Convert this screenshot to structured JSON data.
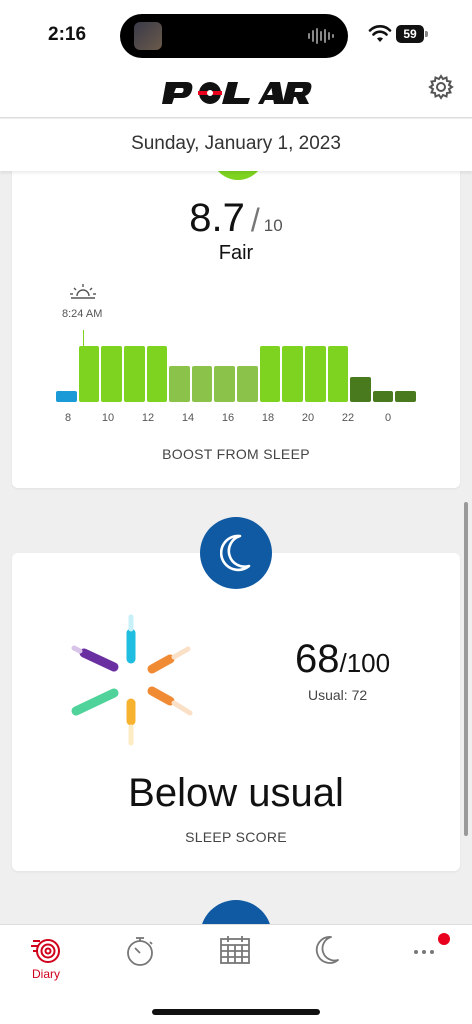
{
  "status_bar": {
    "time": "2:16",
    "battery": "59",
    "icons": [
      "wifi-icon",
      "battery-icon"
    ]
  },
  "header": {
    "logo_text": "POLAR",
    "settings_icon": "gear-icon"
  },
  "date": "Sunday, January 1, 2023",
  "nightly_recharge": {
    "value": "8.7",
    "slash": "/",
    "max": "10",
    "grade": "Fair",
    "wake_time": "8:24 AM",
    "label": "BOOST FROM SLEEP",
    "colors": {
      "blue": "#1a9ad6",
      "light_green": "#7ed321",
      "mid_green": "#8bc34a",
      "dark_green": "#4a7a1e"
    },
    "chart_data": {
      "type": "bar",
      "xlabel": "",
      "ylabel": "",
      "tick_labels": [
        "8",
        "10",
        "12",
        "14",
        "16",
        "18",
        "20",
        "22",
        "0"
      ],
      "values": [
        0.2,
        1.0,
        1.0,
        1.0,
        1.0,
        0.65,
        0.65,
        0.65,
        0.65,
        1.0,
        1.0,
        1.0,
        1.0,
        0.45,
        0.2,
        0.2
      ],
      "bar_colors": [
        "blue",
        "light_green",
        "light_green",
        "light_green",
        "light_green",
        "mid_green",
        "mid_green",
        "mid_green",
        "mid_green",
        "light_green",
        "light_green",
        "light_green",
        "light_green",
        "dark_green",
        "dark_green",
        "dark_green"
      ]
    }
  },
  "sleep": {
    "score": "68",
    "max": "/100",
    "usual": "Usual: 72",
    "verdict": "Below usual",
    "label": "SLEEP SCORE",
    "badge_icon": "moon-icon",
    "colors": {
      "badge": "#0f5aa3"
    }
  },
  "tabs": [
    {
      "name": "diary",
      "label": "Diary",
      "icon": "diary-icon",
      "active": true
    },
    {
      "name": "training",
      "label": "",
      "icon": "stopwatch-icon"
    },
    {
      "name": "calendar",
      "label": "",
      "icon": "calendar-icon"
    },
    {
      "name": "sleep",
      "label": "",
      "icon": "moon-icon"
    },
    {
      "name": "more",
      "label": "",
      "icon": "more-icon",
      "badge": true
    }
  ]
}
